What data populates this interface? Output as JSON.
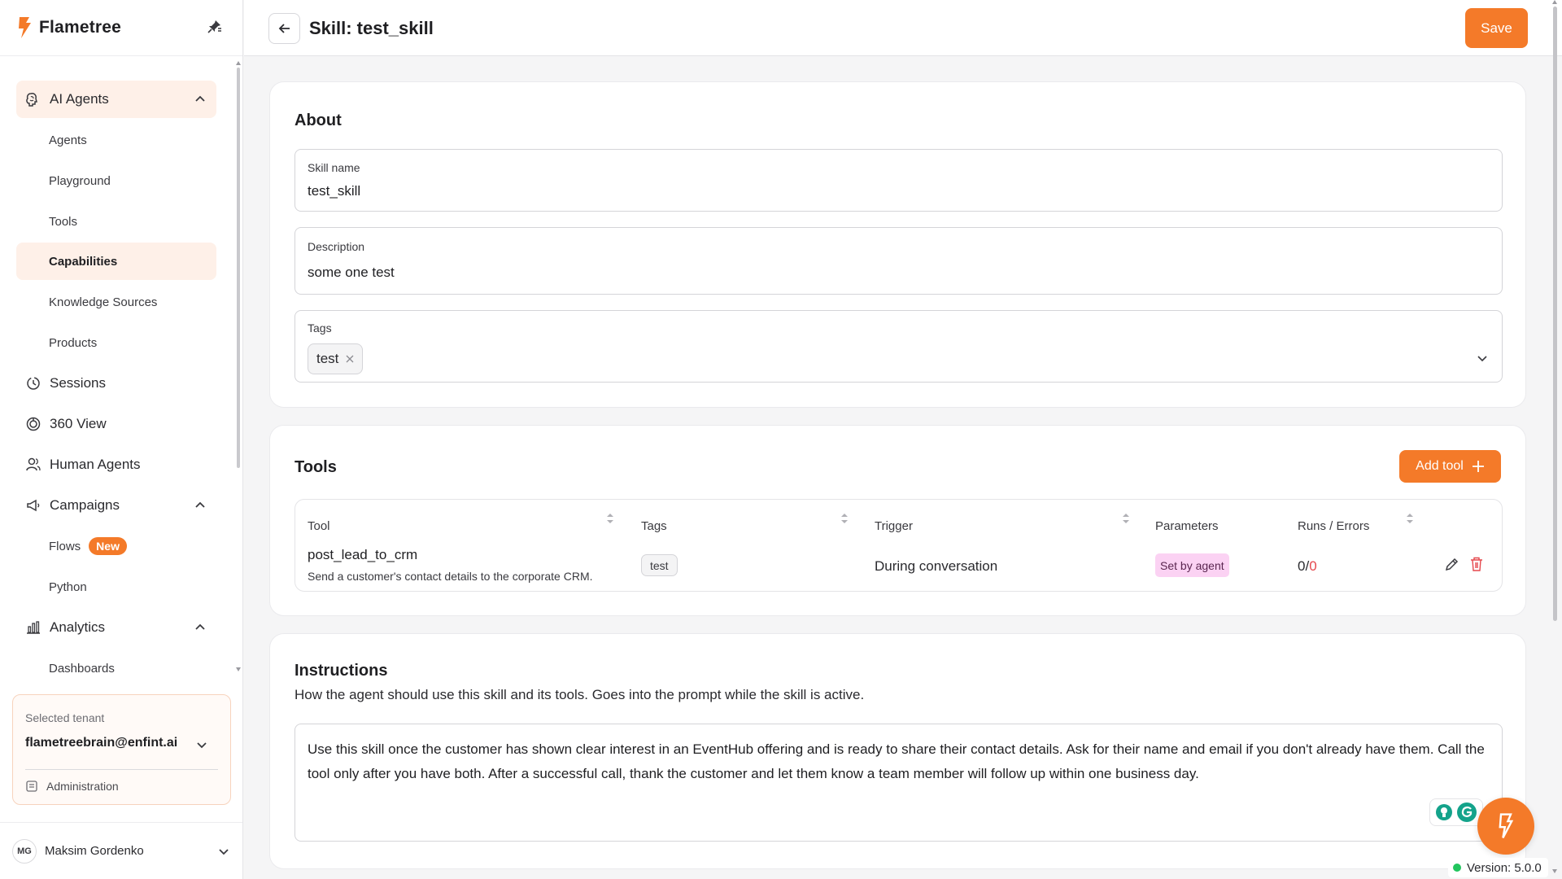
{
  "app": {
    "name": "Flametree",
    "brand_color": "#f47a29"
  },
  "sidebar": {
    "groups": {
      "ai_agents": {
        "label": "AI Agents",
        "icon": "brain-icon",
        "expanded": true
      },
      "sessions": {
        "label": "Sessions",
        "icon": "history-icon"
      },
      "view360": {
        "label": "360 View",
        "icon": "chart-circle-icon"
      },
      "human_agents": {
        "label": "Human Agents",
        "icon": "users-icon"
      },
      "campaigns": {
        "label": "Campaigns",
        "icon": "megaphone-icon",
        "expanded": true
      },
      "analytics": {
        "label": "Analytics",
        "icon": "bar-chart-icon",
        "expanded": true
      }
    },
    "ai_agents_items": [
      "Agents",
      "Playground",
      "Tools",
      "Capabilities",
      "Knowledge Sources",
      "Products"
    ],
    "campaigns_items": [
      "Flows",
      "Python"
    ],
    "flows_badge": "New",
    "analytics_items": [
      "Dashboards"
    ],
    "active_item": "Capabilities"
  },
  "tenant": {
    "label": "Selected tenant",
    "value": "flametreebrain@enfint.ai",
    "admin_label": "Administration"
  },
  "user": {
    "initials": "MG",
    "name": "Maksim Gordenko"
  },
  "header": {
    "title": "Skill: test_skill",
    "save_label": "Save"
  },
  "about": {
    "title": "About",
    "skill_name_label": "Skill name",
    "skill_name_value": "test_skill",
    "description_label": "Description",
    "description_value": "some one test",
    "tags_label": "Tags",
    "tags": [
      "test"
    ]
  },
  "tools": {
    "title": "Tools",
    "add_label": "Add tool",
    "columns": [
      "Tool",
      "Tags",
      "Trigger",
      "Parameters",
      "Runs / Errors"
    ],
    "rows": [
      {
        "name": "post_lead_to_crm",
        "description": "Send a customer's contact details to the corporate CRM.",
        "tag": "test",
        "trigger": "During conversation",
        "parameters": "Set by agent",
        "runs": "0",
        "runs_sep": "/",
        "errors": "0"
      }
    ]
  },
  "instructions": {
    "title": "Instructions",
    "subtitle": "How the agent should use this skill and its tools. Goes into the prompt while the skill is active.",
    "text": "Use this skill once the customer has shown clear interest in an EventHub offering and is ready to share their contact details. Ask for their name and email if you don't already have them. Call the tool only after you have both. After a successful call, thank the customer and let them know a team member will follow up within one business day."
  },
  "version": {
    "label": "Version: 5.0.0"
  }
}
